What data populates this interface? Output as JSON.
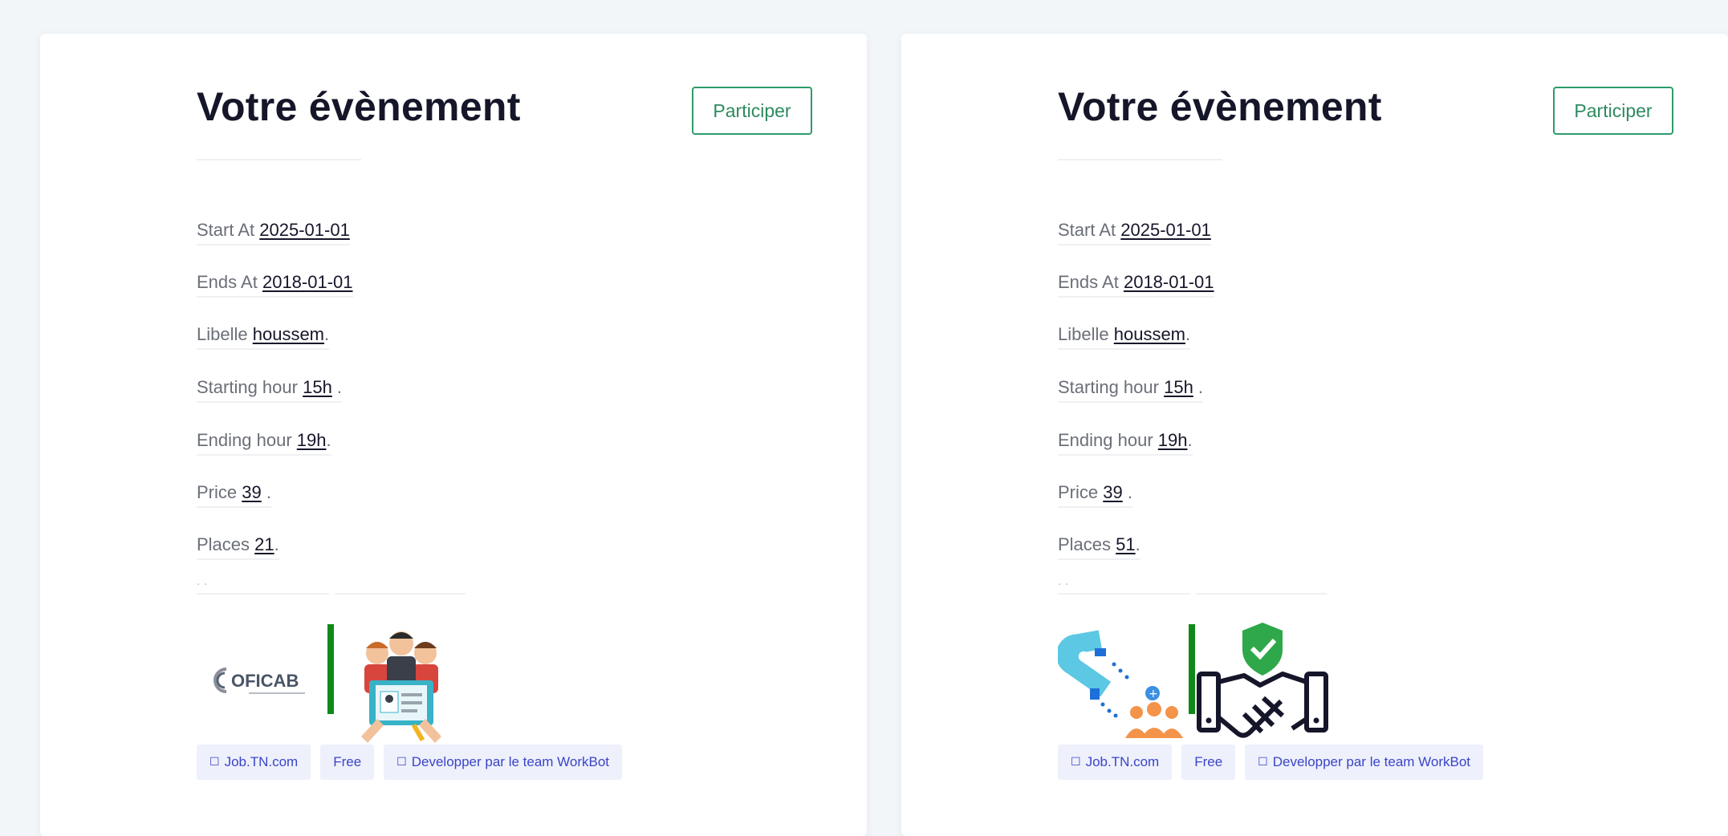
{
  "events": [
    {
      "title": "Votre évènement",
      "participate_label": "Participer",
      "start_label": "Start At",
      "start_value": "2025-01-01",
      "end_label": "Ends At",
      "end_value": "2018-01-01",
      "libelle_label": "Libelle",
      "libelle_value": "houssem",
      "start_hour_label": "Starting hour",
      "start_hour_value": "15h",
      "end_hour_label": "Ending hour",
      "end_hour_value": "19h",
      "price_label": "Price",
      "price_value": "39",
      "places_label": "Places",
      "places_value": "21",
      "sep_dots": ". .",
      "logo_left": "coficab-logo",
      "logo_right": "team-recruiting-illustration",
      "tags": [
        {
          "icon": "square-icon",
          "label": "Job.TN.com"
        },
        {
          "icon": "",
          "label": "Free"
        },
        {
          "icon": "square-icon",
          "label": "Developper par le team WorkBot"
        }
      ]
    },
    {
      "title": "Votre évènement",
      "participate_label": "Participer",
      "start_label": "Start At",
      "start_value": "2025-01-01",
      "end_label": "Ends At",
      "end_value": "2018-01-01",
      "libelle_label": "Libelle",
      "libelle_value": "houssem",
      "start_hour_label": "Starting hour",
      "start_hour_value": "15h",
      "end_hour_label": "Ending hour",
      "end_hour_value": "19h",
      "price_label": "Price",
      "price_value": "39",
      "places_label": "Places",
      "places_value": "51",
      "sep_dots": ". .",
      "logo_left": "magnet-attract-people-icon",
      "logo_right": "handshake-shield-icon",
      "tags": [
        {
          "icon": "square-icon",
          "label": "Job.TN.com"
        },
        {
          "icon": "",
          "label": "Free"
        },
        {
          "icon": "square-icon",
          "label": "Developper par le team WorkBot"
        }
      ]
    }
  ],
  "colors": {
    "accent_green": "#2e9b6a",
    "tag_bg": "#eef0fb",
    "tag_text": "#3a45c8",
    "divider_bar": "#0f8a1a"
  }
}
